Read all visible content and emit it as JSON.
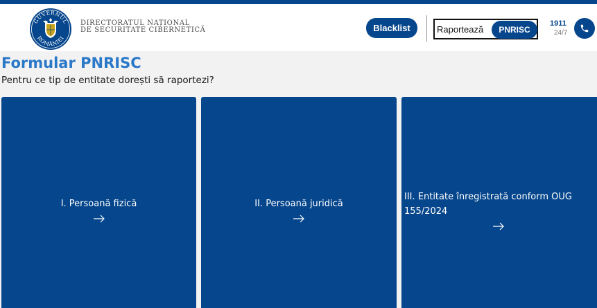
{
  "header": {
    "logo_text_top": "GUVERNUL",
    "logo_text_bottom": "ROMÂNIEI",
    "org_line1": "DIRECTORATUL NAȚIONAL",
    "org_line2": "DE SECURITATE CIBERNETICĂ",
    "blacklist_label": "Blacklist",
    "report_label": "Raportează",
    "pnrisc_label": "PNRISC",
    "hotline_number": "1911",
    "hotline_availability": "24/7",
    "phone_icon": "phone-icon"
  },
  "main": {
    "title": "Formular PNRISC",
    "question": "Pentru ce tip de entitate dorești să raportezi?",
    "options": [
      {
        "label": "I. Persoană fizică",
        "icon": "arrow-right-icon"
      },
      {
        "label": "II. Persoană juridică",
        "icon": "arrow-right-icon"
      },
      {
        "label_line1": "III. Entitate înregistrată conform OUG",
        "label_line2": "155/2024",
        "icon": "arrow-right-icon"
      }
    ]
  },
  "colors": {
    "brand_blue": "#06468c",
    "title_blue": "#2a78c8",
    "background": "#f2f2f2"
  }
}
